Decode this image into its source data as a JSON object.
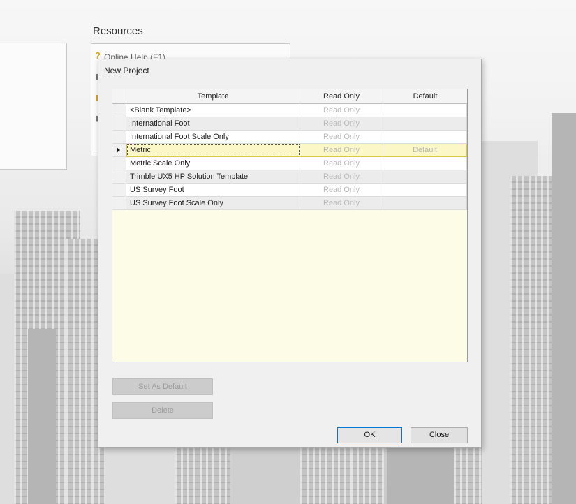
{
  "start_page": {
    "resources_heading": "Resources",
    "first_resource": "Online Help (F1)"
  },
  "dialog": {
    "title": "New Project",
    "columns": {
      "template": "Template",
      "read_only": "Read Only",
      "default": "Default"
    },
    "rows": [
      {
        "template": "<Blank Template>",
        "read_only": "Read Only",
        "default": ""
      },
      {
        "template": "International Foot",
        "read_only": "Read Only",
        "default": ""
      },
      {
        "template": "International Foot Scale Only",
        "read_only": "Read Only",
        "default": ""
      },
      {
        "template": "Metric",
        "read_only": "Read Only",
        "default": "Default"
      },
      {
        "template": "Metric Scale Only",
        "read_only": "Read Only",
        "default": ""
      },
      {
        "template": "Trimble UX5 HP Solution Template",
        "read_only": "Read Only",
        "default": ""
      },
      {
        "template": "US Survey Foot",
        "read_only": "Read Only",
        "default": ""
      },
      {
        "template": "US Survey Foot Scale Only",
        "read_only": "Read Only",
        "default": ""
      }
    ],
    "selected_row": 3,
    "buttons": {
      "set_default": "Set As Default",
      "delete": "Delete",
      "ok": "OK",
      "close": "Close"
    }
  },
  "colors": {
    "grid_empty_bg": "#fdfce6",
    "selected_row_bg": "#fbf7c6",
    "focus_border": "#0078d7",
    "icon_accent": "#d9a21a"
  },
  "icons": [
    "help-icon",
    "row-selector-arrow-icon"
  ]
}
